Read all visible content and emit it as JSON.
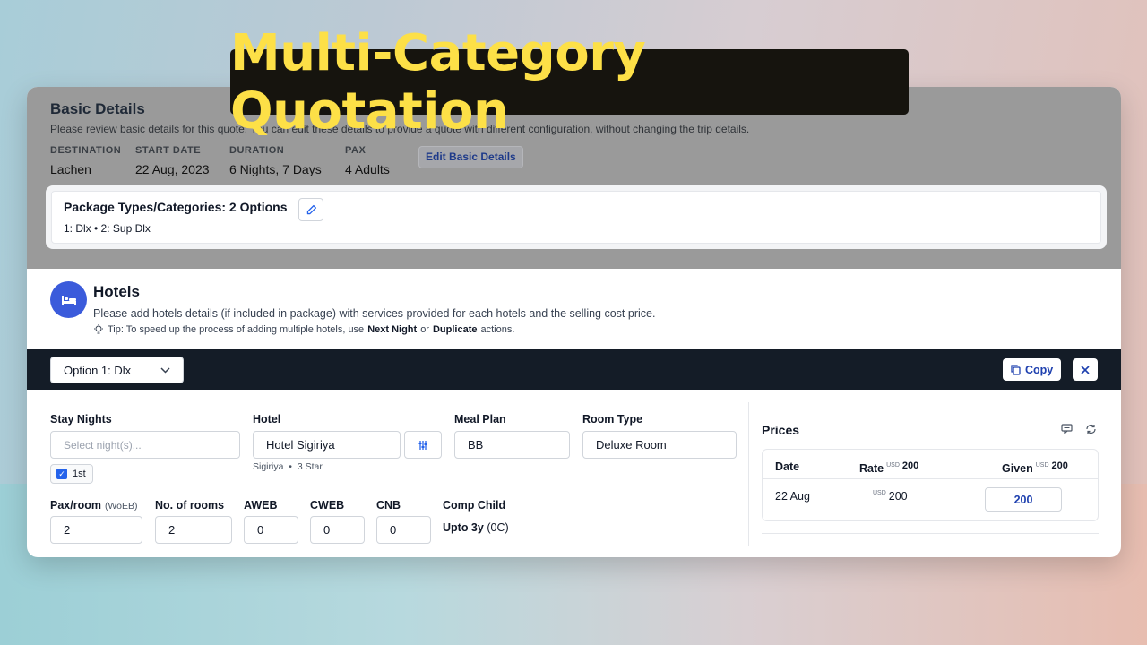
{
  "banner": {
    "title": "Multi-Category Quotation"
  },
  "basic_details": {
    "title": "Basic Details",
    "description": "Please review basic details for this quote. You can edit these details to provide a quote with different configuration, without changing the trip details.",
    "fields": [
      {
        "label": "DESTINATION",
        "value": "Lachen"
      },
      {
        "label": "START DATE",
        "value": "22 Aug, 2023"
      },
      {
        "label": "DURATION",
        "value": "6 Nights, 7 Days"
      },
      {
        "label": "PAX",
        "value": "4 Adults"
      }
    ],
    "edit_button": "Edit Basic Details"
  },
  "package_types": {
    "title": "Package Types/Categories: 2 Options",
    "list": "1: Dlx • 2: Sup Dlx"
  },
  "hotels": {
    "title": "Hotels",
    "description": "Please add hotels details (if included in package) with services provided for each hotels and the selling cost price.",
    "tip_prefix": "Tip: To speed up the process of adding multiple hotels, use",
    "tip_action1": "Next Night",
    "tip_or": "or",
    "tip_action2": "Duplicate",
    "tip_suffix": "actions."
  },
  "option_bar": {
    "selected_option": "Option 1: Dlx",
    "copy_label": "Copy"
  },
  "form": {
    "stay_nights": {
      "label": "Stay Nights",
      "placeholder": "Select night(s)...",
      "checked_night": "1st"
    },
    "hotel": {
      "label": "Hotel",
      "value": "Hotel Sigiriya",
      "location": "Sigiriya",
      "separator": "•",
      "stars": "3 Star"
    },
    "meal_plan": {
      "label": "Meal Plan",
      "value": "BB"
    },
    "room_type": {
      "label": "Room Type",
      "value": "Deluxe Room"
    },
    "pax_room": {
      "label": "Pax/room",
      "sub": "(WoEB)",
      "value": "2"
    },
    "no_of_rooms": {
      "label": "No. of rooms",
      "value": "2"
    },
    "aweb": {
      "label": "AWEB",
      "value": "0"
    },
    "cweb": {
      "label": "CWEB",
      "value": "0"
    },
    "cnb": {
      "label": "CNB",
      "value": "0"
    },
    "comp_child": {
      "label": "Comp Child",
      "value_bold": "Upto 3y",
      "value_rest": "(0C)"
    }
  },
  "prices": {
    "title": "Prices",
    "headers": {
      "date": "Date",
      "rate": "Rate",
      "rate_currency": "USD",
      "rate_total": "200",
      "given": "Given",
      "given_currency": "USD",
      "given_total": "200"
    },
    "rows": [
      {
        "date": "22 Aug",
        "rate_currency": "USD",
        "rate": "200",
        "given": "200"
      }
    ]
  }
}
